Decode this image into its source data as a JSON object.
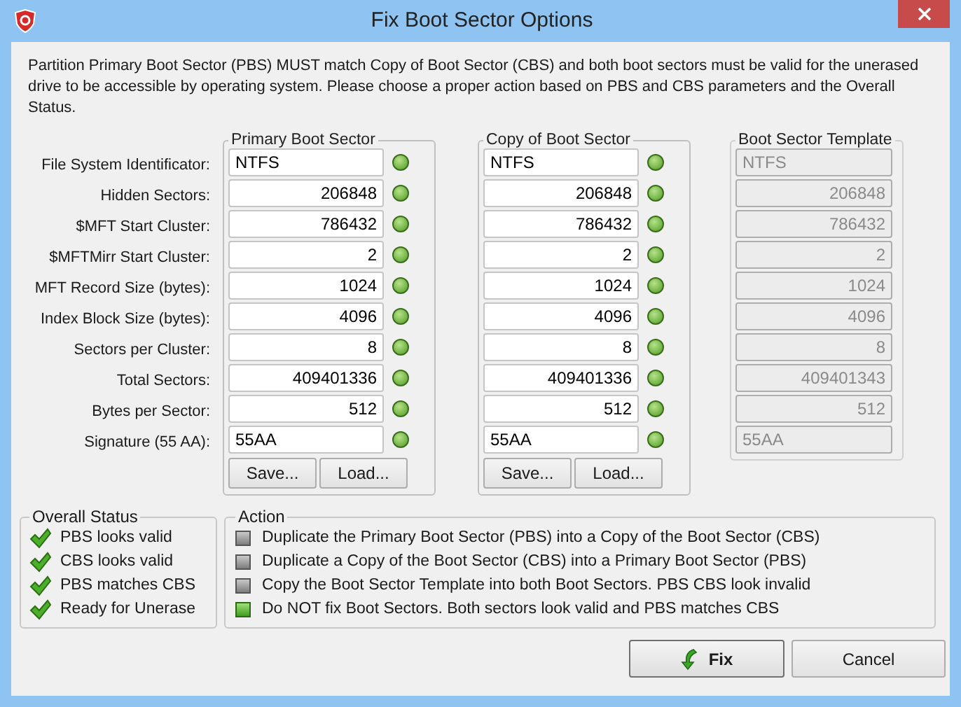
{
  "window": {
    "title": "Fix Boot Sector Options"
  },
  "description": "Partition Primary Boot Sector (PBS) MUST match Copy of Boot Sector (CBS) and both boot sectors must be valid for the unerased drive to be accessible by operating system. Please choose a proper action based on PBS and CBS parameters and the Overall Status.",
  "row_labels": [
    "File System Identificator:",
    "Hidden Sectors:",
    "$MFT Start Cluster:",
    "$MFTMirr Start Cluster:",
    "MFT Record Size (bytes):",
    "Index Block Size (bytes):",
    "Sectors per Cluster:",
    "Total Sectors:",
    "Bytes per Sector:",
    "Signature (55 AA):"
  ],
  "sectors": [
    {
      "title": "Primary Boot Sector",
      "disabled": false,
      "values": [
        {
          "text": "NTFS",
          "ok": true
        },
        {
          "text": "206848",
          "ok": true
        },
        {
          "text": "786432",
          "ok": true
        },
        {
          "text": "2",
          "ok": true
        },
        {
          "text": "1024",
          "ok": true
        },
        {
          "text": "4096",
          "ok": true
        },
        {
          "text": "8",
          "ok": true
        },
        {
          "text": "409401336",
          "ok": true
        },
        {
          "text": "512",
          "ok": true
        },
        {
          "text": "55AA",
          "ok": true
        }
      ],
      "buttons": [
        "Save...",
        "Load..."
      ]
    },
    {
      "title": "Copy of Boot Sector",
      "disabled": false,
      "values": [
        {
          "text": "NTFS",
          "ok": true
        },
        {
          "text": "206848",
          "ok": true
        },
        {
          "text": "786432",
          "ok": true
        },
        {
          "text": "2",
          "ok": true
        },
        {
          "text": "1024",
          "ok": true
        },
        {
          "text": "4096",
          "ok": true
        },
        {
          "text": "8",
          "ok": true
        },
        {
          "text": "409401336",
          "ok": true
        },
        {
          "text": "512",
          "ok": true
        },
        {
          "text": "55AA",
          "ok": true
        }
      ],
      "buttons": [
        "Save...",
        "Load..."
      ]
    },
    {
      "title": "Boot Sector Template",
      "disabled": true,
      "values": [
        {
          "text": "NTFS"
        },
        {
          "text": "206848"
        },
        {
          "text": "786432"
        },
        {
          "text": "2"
        },
        {
          "text": "1024"
        },
        {
          "text": "4096"
        },
        {
          "text": "8"
        },
        {
          "text": "409401343"
        },
        {
          "text": "512"
        },
        {
          "text": "55AA"
        }
      ]
    }
  ],
  "overall_status": {
    "title": "Overall Status",
    "items": [
      {
        "label": "PBS looks valid",
        "checked": true
      },
      {
        "label": "CBS looks valid",
        "checked": true
      },
      {
        "label": "PBS matches CBS",
        "checked": true
      },
      {
        "label": "Ready for Unerase",
        "checked": true
      }
    ]
  },
  "action": {
    "title": "Action",
    "options": [
      {
        "label": "Duplicate the Primary Boot Sector (PBS) into a Copy of the Boot Sector (CBS)",
        "selected": false
      },
      {
        "label": "Duplicate a Copy of the Boot Sector (CBS) into a Primary Boot Sector (PBS)",
        "selected": false
      },
      {
        "label": "Copy the Boot Sector Template into both Boot Sectors. PBS  CBS look invalid",
        "selected": false
      },
      {
        "label": "Do NOT fix Boot Sectors. Both sectors look valid and PBS matches CBS",
        "selected": true
      }
    ]
  },
  "buttons": {
    "fix": "Fix",
    "cancel": "Cancel"
  }
}
